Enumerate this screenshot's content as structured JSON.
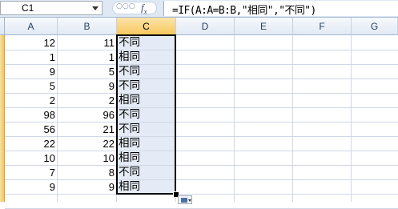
{
  "formula_bar": {
    "name_box": "C1",
    "dots": "○○○",
    "fx_label": "fx",
    "formula": "=IF(A:A=B:B,\"相同\",\"不同\")"
  },
  "columns": [
    "A",
    "B",
    "C",
    "D",
    "E",
    "F",
    "G"
  ],
  "selected_column": "C",
  "rows": [
    {
      "a": "12",
      "b": "11",
      "c": "不同"
    },
    {
      "a": "1",
      "b": "1",
      "c": "相同"
    },
    {
      "a": "9",
      "b": "5",
      "c": "不同"
    },
    {
      "a": "5",
      "b": "9",
      "c": "不同"
    },
    {
      "a": "2",
      "b": "2",
      "c": "相同"
    },
    {
      "a": "98",
      "b": "96",
      "c": "不同"
    },
    {
      "a": "56",
      "b": "21",
      "c": "不同"
    },
    {
      "a": "22",
      "b": "22",
      "c": "相同"
    },
    {
      "a": "10",
      "b": "10",
      "c": "相同"
    },
    {
      "a": "7",
      "b": "8",
      "c": "不同"
    },
    {
      "a": "9",
      "b": "9",
      "c": "相同"
    }
  ]
}
